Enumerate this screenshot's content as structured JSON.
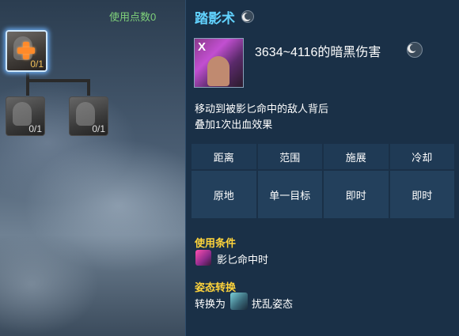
{
  "skill_tree": {
    "points_used_label": "使用点数0",
    "nodes": [
      {
        "count": "0/1"
      },
      {
        "count": "0/1"
      },
      {
        "count": "0/1"
      }
    ]
  },
  "detail": {
    "skill_name": "踏影术",
    "icon_key_label": "X",
    "damage_text": "3634~4116的暗黑伤害",
    "description_lines": [
      "移动到被影匕命中的敌人背后",
      "叠加1次出血效果"
    ],
    "stats": {
      "headers": [
        "距离",
        "范围",
        "施展",
        "冷却"
      ],
      "values": [
        "原地",
        "单一目标",
        "即时",
        "即时"
      ]
    },
    "condition": {
      "title": "使用条件",
      "text": "影匕命中时"
    },
    "stance": {
      "title": "姿态转换",
      "prefix": "转换为",
      "target": "扰乱姿态"
    }
  },
  "colors": {
    "title": "#62d3ff",
    "section_title": "#ffd43b",
    "points": "#7fd17a"
  }
}
